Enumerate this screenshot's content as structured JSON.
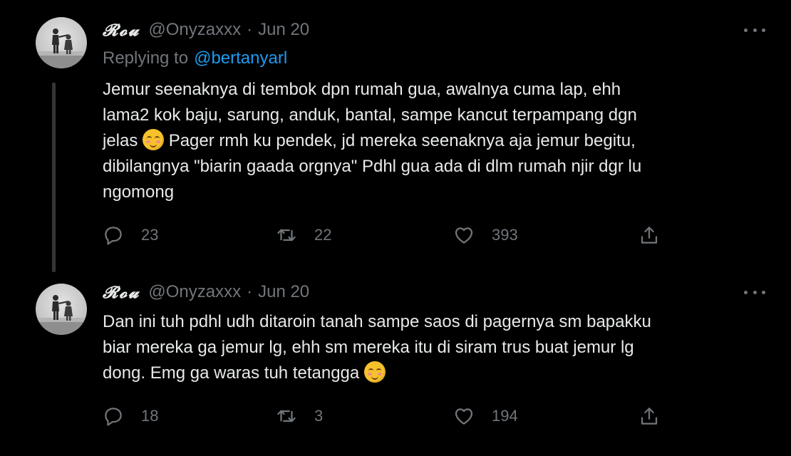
{
  "tweets": [
    {
      "display_name": "𝓡𝓸𝓾",
      "handle": "@Onyzaxxx",
      "separator": "·",
      "date": "Jun 20",
      "replying_to_label": "Replying to",
      "replying_to_handle": "@bertanyarl",
      "text_lines": [
        "Jemur seenaknya di tembok dpn rumah gua, awalnya cuma lap, ehh",
        "lama2 kok baju, sarung, anduk, bantal, sampe kancut terpampang dgn",
        "jelas",
        " Pager rmh ku pendek, jd mereka seenaknya aja jemur begitu,",
        "dibilangnya \"biarin gaada orgnya\" Pdhl gua ada di dlm rumah njir dgr lu",
        "ngomong"
      ],
      "emoji": "smiling-face-with-blush",
      "replies": "23",
      "retweets": "22",
      "likes": "393"
    },
    {
      "display_name": "𝓡𝓸𝓾",
      "handle": "@Onyzaxxx",
      "separator": "·",
      "date": "Jun 20",
      "text_lines": [
        "Dan ini tuh pdhl udh ditaroin tanah sampe saos di pagernya sm bapakku",
        "biar mereka ga jemur lg, ehh sm mereka itu di siram trus buat jemur lg",
        "dong. Emg ga waras tuh tetangga"
      ],
      "emoji": "smiling-face-with-blush",
      "replies": "18",
      "retweets": "3",
      "likes": "194"
    }
  ],
  "colors": {
    "background": "#000000",
    "text": "#e7e9ea",
    "secondary": "#71767b",
    "link": "#1d9bf0",
    "thread_line": "#333639"
  },
  "icons": [
    "more-icon",
    "reply-icon",
    "retweet-icon",
    "like-icon",
    "share-icon"
  ]
}
